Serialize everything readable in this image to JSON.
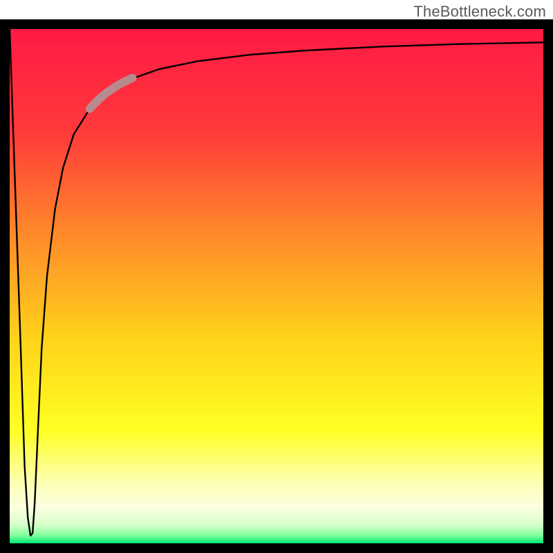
{
  "watermark": "TheBottleneck.com",
  "chart_data": {
    "type": "line",
    "title": "",
    "xlabel": "",
    "ylabel": "",
    "xlim": [
      0,
      100
    ],
    "ylim": [
      0,
      100
    ],
    "grid": false,
    "legend": false,
    "border_px": 14,
    "gradient_stops": [
      {
        "offset": 0.0,
        "color": "#ff1a44"
      },
      {
        "offset": 0.2,
        "color": "#ff3a3a"
      },
      {
        "offset": 0.4,
        "color": "#ff8a2a"
      },
      {
        "offset": 0.6,
        "color": "#ffd21a"
      },
      {
        "offset": 0.78,
        "color": "#ffff22"
      },
      {
        "offset": 0.88,
        "color": "#fdffb0"
      },
      {
        "offset": 0.93,
        "color": "#fbffe0"
      },
      {
        "offset": 0.965,
        "color": "#d4ffc8"
      },
      {
        "offset": 0.985,
        "color": "#7fff9c"
      },
      {
        "offset": 1.0,
        "color": "#00e676"
      }
    ],
    "series": [
      {
        "name": "bottleneck_percent",
        "x": [
          0.0,
          1.0,
          2.0,
          2.8,
          3.4,
          3.9,
          4.3,
          4.7,
          5.3,
          6.0,
          7.0,
          8.5,
          10.0,
          12.0,
          15.0,
          18.0,
          22.0,
          28.0,
          35.0,
          45.0,
          55.0,
          70.0,
          85.0,
          100.0
        ],
        "values": [
          100.0,
          70.0,
          40.0,
          15.0,
          5.0,
          1.5,
          2.0,
          8.0,
          22.0,
          38.0,
          52.0,
          65.0,
          73.0,
          79.5,
          84.5,
          87.5,
          90.0,
          92.2,
          93.7,
          95.0,
          95.8,
          96.6,
          97.1,
          97.4
        ]
      }
    ],
    "highlight": {
      "x": [
        15.0,
        16.0,
        17.0,
        18.0,
        19.0,
        20.0,
        21.0,
        22.0,
        23.0
      ],
      "values": [
        84.5,
        85.6,
        86.6,
        87.5,
        88.2,
        88.9,
        89.5,
        90.0,
        90.5
      ],
      "stroke": "#b88a8e",
      "stroke_width": 12
    }
  }
}
